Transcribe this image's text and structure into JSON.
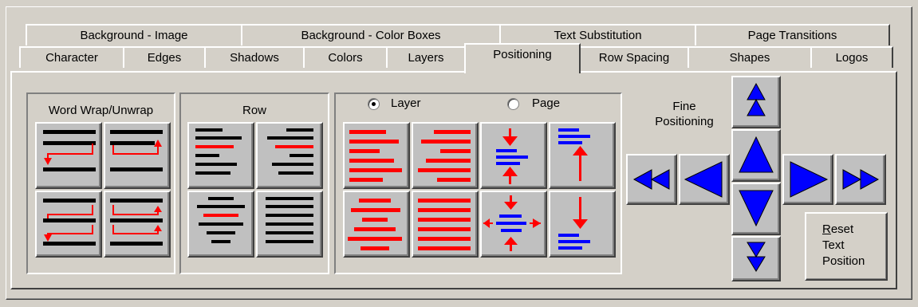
{
  "tabs_back": [
    {
      "label": "Background - Image"
    },
    {
      "label": "Background - Color Boxes"
    },
    {
      "label": "Text Substitution"
    },
    {
      "label": "Page Transitions"
    }
  ],
  "tabs_front": [
    {
      "label": "Character"
    },
    {
      "label": "Edges"
    },
    {
      "label": "Shadows"
    },
    {
      "label": "Colors"
    },
    {
      "label": "Layers"
    },
    {
      "label": "Positioning"
    },
    {
      "label": "Row Spacing"
    },
    {
      "label": "Shapes"
    },
    {
      "label": "Logos"
    }
  ],
  "active_tab": "Positioning",
  "word_wrap": {
    "title": "Word Wrap/Unwrap"
  },
  "row": {
    "title": "Row"
  },
  "align": {
    "radio_layer": "Layer",
    "radio_page": "Page",
    "selected": "Layer"
  },
  "fine": {
    "line1": "Fine",
    "line2": "Positioning"
  },
  "reset": {
    "line1_first": "R",
    "line1_rest": "eset",
    "line2": "Text",
    "line3": "Position"
  },
  "colors": {
    "red": "#ff0000",
    "blue": "#0000ff",
    "black": "#000000",
    "face": "#c0c0c0",
    "bg": "#d4d0c8"
  },
  "icons": [
    "wrap-left-icon",
    "wrap-right-icon",
    "unwrap-left-icon",
    "unwrap-right-icon",
    "row-highlight-icon",
    "row-center-icon",
    "align-left-icon",
    "align-right-icon",
    "align-top-icon",
    "align-vcenter-icon",
    "align-center-icon",
    "align-justify-icon",
    "align-middle-icon",
    "align-bottom-icon",
    "fast-left-icon",
    "left-icon",
    "fast-up-icon",
    "up-icon",
    "down-icon",
    "fast-down-icon",
    "right-icon",
    "fast-right-icon"
  ]
}
